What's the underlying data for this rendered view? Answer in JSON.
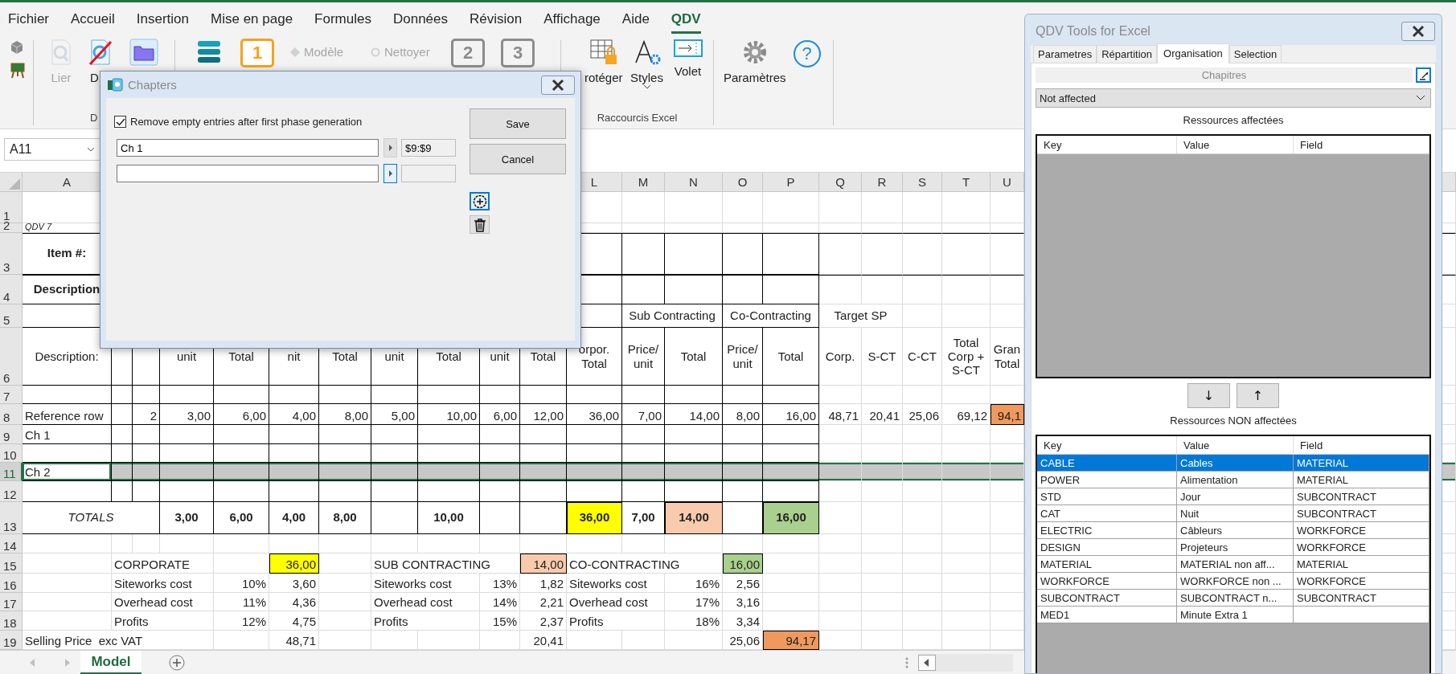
{
  "menu_tabs": [
    {
      "label": "Fichier",
      "selected": false
    },
    {
      "label": "Accueil",
      "selected": false
    },
    {
      "label": "Insertion",
      "selected": false
    },
    {
      "label": "Mise en page",
      "selected": false
    },
    {
      "label": "Formules",
      "selected": false
    },
    {
      "label": "Données",
      "selected": false
    },
    {
      "label": "Révision",
      "selected": false
    },
    {
      "label": "Affichage",
      "selected": false
    },
    {
      "label": "Aide",
      "selected": false
    },
    {
      "label": "QDV",
      "selected": true
    }
  ],
  "ribbon": {
    "groups": [
      {
        "kind": "misc",
        "items": [
          {
            "kind": "cube"
          },
          {
            "kind": "easel"
          }
        ]
      },
      {
        "kind": "links",
        "label": "D",
        "items": [
          {
            "kind": "link-doc",
            "label": "Lier",
            "disabled": true
          },
          {
            "kind": "crossed-doc",
            "label": "D",
            "disabled": false
          },
          {
            "kind": "folder"
          }
        ]
      },
      {
        "kind": "steps",
        "items": [
          {
            "kind": "stack"
          },
          {
            "kind": "step",
            "label": "1",
            "disabled": false
          },
          {
            "kind": "small-diamond",
            "label": "Modèle",
            "disabled": true
          },
          {
            "kind": "small-circle",
            "label": "Nettoyer",
            "disabled": true
          },
          {
            "kind": "step",
            "label": "2",
            "disabled": true
          },
          {
            "kind": "step",
            "label": "3",
            "disabled": true
          }
        ]
      },
      {
        "kind": "shortcuts",
        "label": "Raccourcis Excel",
        "items": [
          {
            "kind": "grid-lock",
            "label": "rotéger",
            "disabled": false
          },
          {
            "kind": "styles",
            "label": "Styles",
            "disabled": false
          },
          {
            "kind": "panel-arrow",
            "label": "Volet",
            "disabled": false
          }
        ]
      },
      {
        "kind": "settings",
        "items": [
          {
            "kind": "gear",
            "label": "Paramètres",
            "disabled": false
          },
          {
            "kind": "help",
            "label": "?"
          }
        ]
      }
    ]
  },
  "name_box": "A11",
  "sheet": {
    "columns": {
      "A": "A",
      "L": "L",
      "M": "M",
      "N": "N",
      "O": "O",
      "P": "P",
      "Q": "Q",
      "R": "R",
      "S": "S",
      "T": "T",
      "U": "U"
    },
    "rows": [
      {
        "number": "1",
        "kind": "plain",
        "selected": false
      },
      {
        "number": "2",
        "kind": "note",
        "selected": false,
        "cells": {
          "A": "QDV 7"
        }
      },
      {
        "number": "3",
        "kind": "title",
        "selected": false,
        "cells": {
          "A": "Item #:"
        }
      },
      {
        "number": "4",
        "kind": "title",
        "selected": false,
        "cells": {
          "A": "Description"
        }
      },
      {
        "number": "5",
        "kind": "table-head",
        "selected": false,
        "cells": {
          "M:N": "Sub Contracting",
          "O:P": "Co-Contracting",
          "Q:R": "Target SP"
        }
      },
      {
        "number": "6",
        "kind": "table-head",
        "selected": false,
        "cells": {
          "A": "Description:",
          "D": "unit",
          "E": "Total",
          "F": "nit",
          "G": "Total",
          "H": "unit",
          "I": "Total",
          "J": "unit",
          "K": "Total",
          "L": "orpor. Total",
          "M": "Price/ unit",
          "N": "Total",
          "O": "Price/ unit",
          "P": "Total",
          "Q": "Corp.",
          "R": "S-CT",
          "S": "C-CT",
          "T": "Total Corp + S-CT",
          "U": "Gran Total"
        }
      },
      {
        "number": "7",
        "kind": "table",
        "selected": false
      },
      {
        "number": "8",
        "kind": "table",
        "selected": false,
        "cells": {
          "A": "Reference row",
          "C": "2",
          "D": "3,00",
          "E": "6,00",
          "F": "4,00",
          "G": "8,00",
          "H": "5,00",
          "I": "10,00",
          "J": "6,00",
          "K": "12,00",
          "L": "36,00",
          "M": "7,00",
          "N": "14,00",
          "O": "8,00",
          "P": "16,00",
          "Q": "48,71",
          "R": "20,41",
          "S": "25,06",
          "T": "69,12",
          "U": {
            "text": "94,1",
            "color": "#f0995e"
          }
        }
      },
      {
        "number": "9",
        "kind": "table",
        "selected": false,
        "cells": {
          "A": "Ch 1"
        }
      },
      {
        "number": "10",
        "kind": "table",
        "selected": false
      },
      {
        "number": "11",
        "kind": "table",
        "selected": true,
        "cells": {
          "A": "Ch 2"
        }
      },
      {
        "number": "12",
        "kind": "table",
        "selected": false
      },
      {
        "number": "13",
        "kind": "totals",
        "selected": false,
        "cells": {
          "A:C": "TOTALS",
          "D": "3,00",
          "E": "6,00",
          "F": "4,00",
          "G": "8,00",
          "I": "10,00",
          "L": {
            "text": "36,00",
            "color": "#ffff00"
          },
          "M": "7,00",
          "N": {
            "text": "14,00",
            "color": "#f8cbad"
          },
          "P": {
            "text": "16,00",
            "color": "#a9d08e"
          }
        }
      },
      {
        "number": "14",
        "kind": "plain",
        "selected": false
      },
      {
        "number": "15",
        "kind": "summary",
        "selected": false,
        "cells": {
          "B:D": "CORPORATE",
          "F": {
            "text": "36,00",
            "color": "#ffff00"
          },
          "H:J": "SUB CONTRACTING",
          "K": {
            "text": "14,00",
            "color": "#f8cbad"
          },
          "L:N": "CO-CONTRACTING",
          "O": {
            "text": "16,00",
            "color": "#a9d08e"
          }
        }
      },
      {
        "number": "16",
        "kind": "summary",
        "selected": false,
        "cells": {
          "B:D": "Siteworks cost",
          "E": "10%",
          "F": "3,60",
          "H:I": "Siteworks cost",
          "J": "13%",
          "K": "1,82",
          "L:M": "Siteworks cost",
          "N": "16%",
          "O": "2,56"
        }
      },
      {
        "number": "17",
        "kind": "summary",
        "selected": false,
        "cells": {
          "B:D": "Overhead cost",
          "E": "11%",
          "F": "4,36",
          "H:I": "Overhead cost",
          "J": "14%",
          "K": "2,21",
          "L:M": "Overhead cost",
          "N": "17%",
          "O": "3,16"
        }
      },
      {
        "number": "18",
        "kind": "summary",
        "selected": false,
        "cells": {
          "B:D": "Profits",
          "E": "12%",
          "F": "4,75",
          "H:I": "Profits",
          "J": "15%",
          "K": "2,37",
          "L:M": "Profits",
          "N": "18%",
          "O": "3,34"
        }
      },
      {
        "number": "19",
        "kind": "summary",
        "selected": false,
        "cells": {
          "A:D": "Selling Price  exc VAT",
          "F": "48,71",
          "K": "20,41",
          "O": "25,06",
          "P": {
            "text": "94,17",
            "color": "#f0995e"
          }
        }
      }
    ]
  },
  "sheet_tabs": [
    {
      "label": "Model",
      "selected": true
    }
  ],
  "dialog": {
    "title": "Chapters",
    "remove_empty": {
      "label": "Remove empty entries after first phase generation",
      "checked": true
    },
    "chapters": [
      {
        "name": "Ch 1",
        "range": "$9:$9",
        "focused": false
      },
      {
        "focused": true
      }
    ],
    "buttons": [
      "Save",
      "Cancel"
    ],
    "add_button": {
      "focused": true
    }
  },
  "tools_panel": {
    "title": "QDV Tools for Excel",
    "tabs": [
      {
        "label": "Parametres",
        "selected": false
      },
      {
        "label": "Répartition",
        "selected": false
      },
      {
        "label": "Organisation",
        "selected": true
      },
      {
        "label": "Selection",
        "selected": false
      }
    ],
    "section_label": "Chapitres",
    "dropdown": {
      "value": "Not affected"
    },
    "assigned": {
      "label": "Ressources affectées",
      "columns": [
        "Key",
        "Value",
        "Field"
      ]
    },
    "move_buttons": [
      "↓",
      "↑"
    ],
    "unassigned": {
      "label": "Ressources NON affectées",
      "columns": [
        "Key",
        "Value",
        "Field"
      ],
      "rows": [
        {
          "key": "CABLE",
          "value": "Cables",
          "field": "MATERIAL",
          "selected": true
        },
        {
          "key": "POWER",
          "value": "Alimentation",
          "field": "MATERIAL",
          "selected": false
        },
        {
          "key": "STD",
          "value": "Jour",
          "field": "SUBCONTRACT",
          "selected": false
        },
        {
          "key": "CAT",
          "value": "Nuit",
          "field": "SUBCONTRACT",
          "selected": false
        },
        {
          "key": "ELECTRIC",
          "value": "Câbleurs",
          "field": "WORKFORCE",
          "selected": false
        },
        {
          "key": "DESIGN",
          "value": "Projeteurs",
          "field": "WORKFORCE",
          "selected": false
        },
        {
          "key": "MATERIAL",
          "value": "MATERIAL non aff...",
          "field": "MATERIAL",
          "selected": false
        },
        {
          "key": "WORKFORCE",
          "value": "WORKFORCE non ...",
          "field": "WORKFORCE",
          "selected": false
        },
        {
          "key": "SUBCONTRACT",
          "value": "SUBCONTRACT n...",
          "field": "SUBCONTRACT",
          "selected": false
        },
        {
          "key": "MED1",
          "value": "Minute Extra 1",
          "selected": false
        }
      ]
    }
  }
}
